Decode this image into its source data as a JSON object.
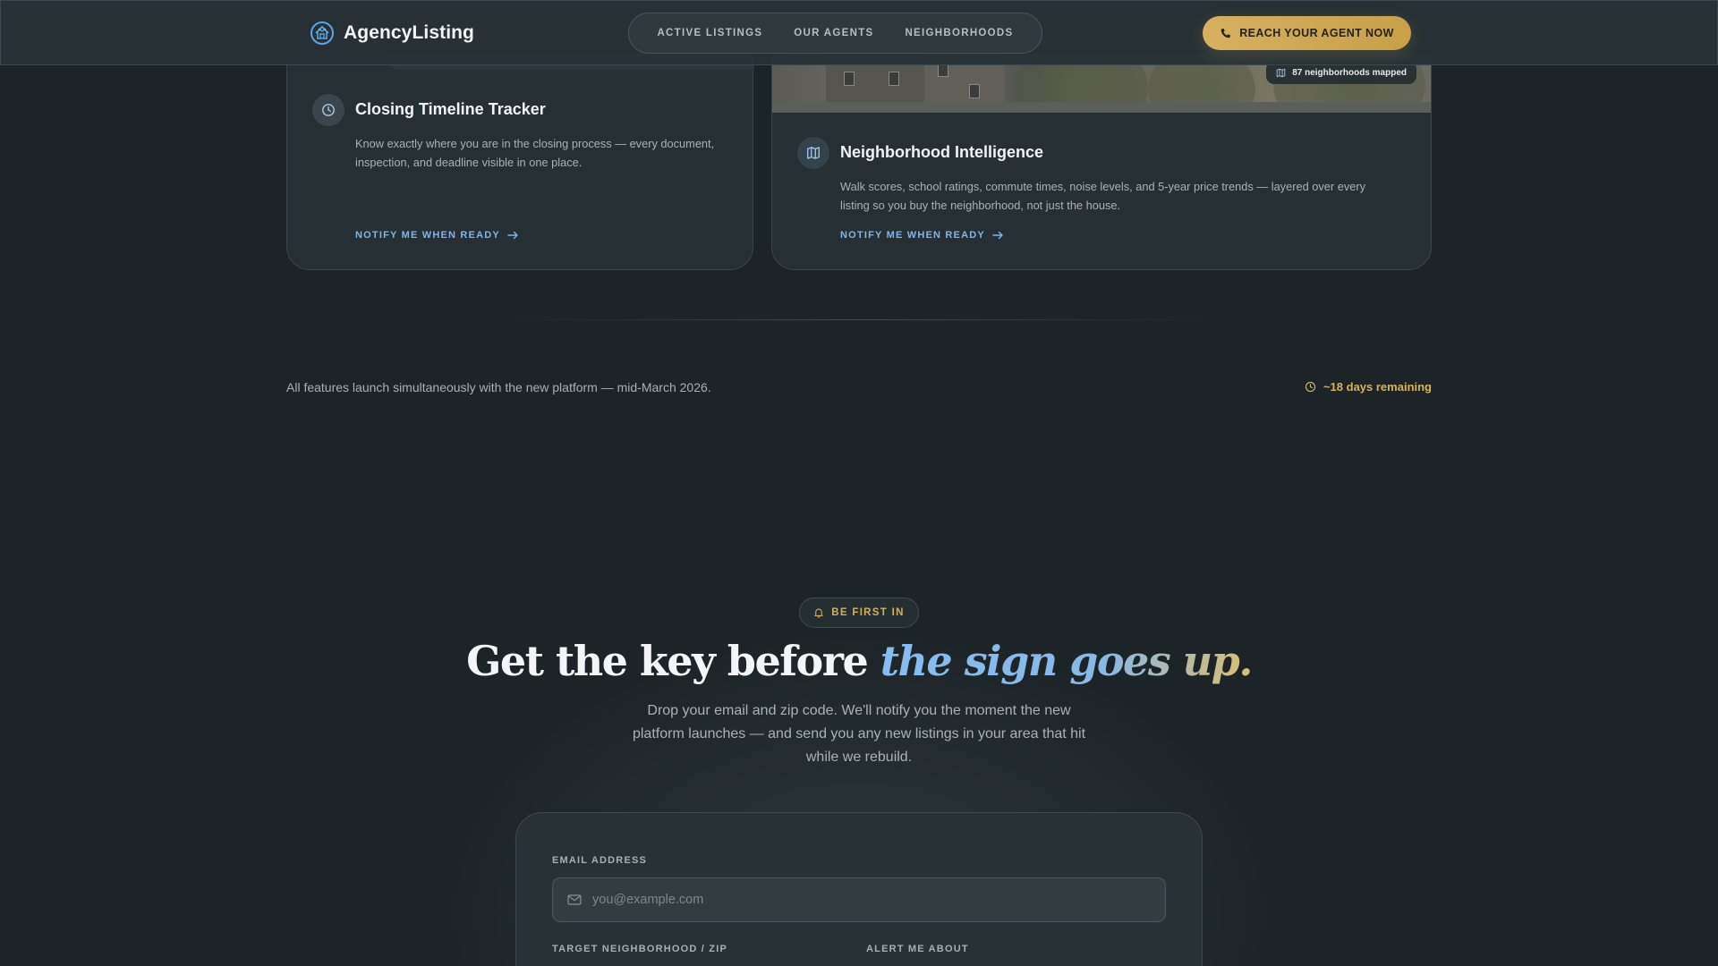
{
  "header": {
    "brand_name": "AgencyListing",
    "nav": [
      "ACTIVE LISTINGS",
      "OUR AGENTS",
      "NEIGHBORHOODS"
    ],
    "cta_label": "REACH YOUR AGENT NOW"
  },
  "features": {
    "left": {
      "title": "Closing Timeline Tracker",
      "description": "Know exactly where you are in the closing process — every document, inspection, and deadline visible in one place.",
      "notify_label": "NOTIFY ME WHEN READY",
      "icon": "clock-icon"
    },
    "right": {
      "badge": "87 neighborhoods mapped",
      "title": "Neighborhood Intelligence",
      "description": "Walk scores, school ratings, commute times, noise levels, and 5-year price trends — layered over every listing so you buy the neighborhood, not just the house.",
      "notify_label": "NOTIFY ME WHEN READY",
      "icon": "map-icon"
    }
  },
  "launch": {
    "note": "All features launch simultaneously with the new platform — mid-March 2026.",
    "remaining": "~18 days remaining"
  },
  "signup": {
    "pill": "BE FIRST IN",
    "headline_start": "Get the key before ",
    "headline_accent": "the sign goes up.",
    "subtext": "Drop your email and zip code. We'll notify you the moment the new platform launches — and send you any new listings in your area that hit while we rebuild.",
    "email_label": "EMAIL ADDRESS",
    "email_placeholder": "you@example.com",
    "zip_label": "TARGET NEIGHBORHOOD / ZIP",
    "alert_label": "ALERT ME ABOUT"
  },
  "colors": {
    "accent_gold": "#d6b060",
    "accent_blue": "#7fb6e8",
    "background": "#1c2427"
  }
}
